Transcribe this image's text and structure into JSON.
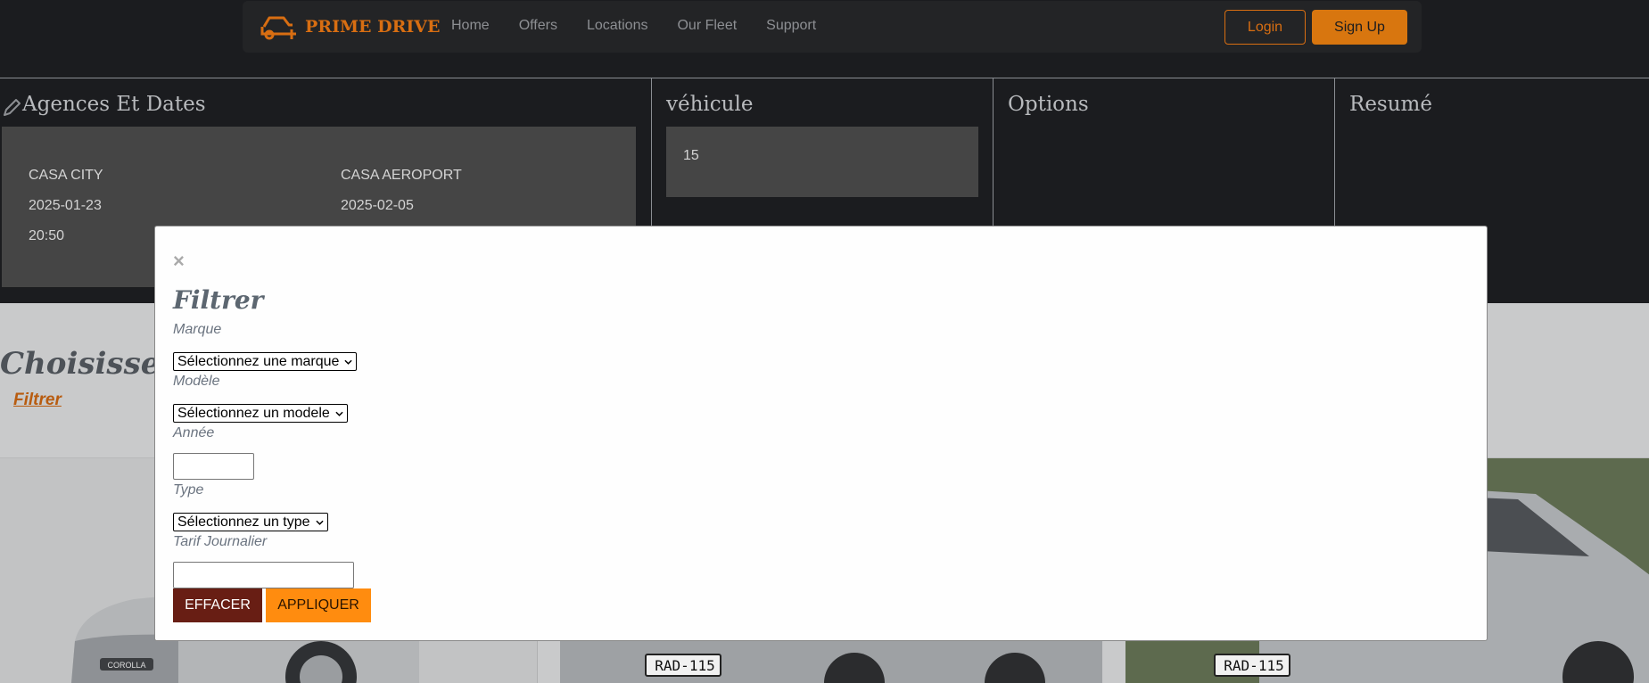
{
  "nav": {
    "brand": "PRIME DRIVE",
    "links": [
      "Home",
      "Offers",
      "Locations",
      "Our Fleet",
      "Support"
    ],
    "login": "Login",
    "signup": "Sign Up"
  },
  "steps": {
    "agencies": {
      "title": "Agences Et Dates",
      "pickup": {
        "agency": "CASA CITY",
        "date": "2025-01-23",
        "time": "20:50"
      },
      "return": {
        "agency": "CASA AEROPORT",
        "date": "2025-02-05"
      }
    },
    "vehicle": {
      "title": "véhicule",
      "value": "15"
    },
    "options": {
      "title": "Options"
    },
    "summary": {
      "title": "Resumé"
    }
  },
  "main": {
    "heading": "Choisissez v",
    "filter_link": "Filtrer"
  },
  "modal": {
    "close": "×",
    "title": "Filtrer",
    "brand_label": "Marque",
    "brand_select": "Sélectionnez une marque",
    "model_label": "Modèle",
    "model_select": "Sélectionnez un modele",
    "year_label": "Année",
    "year_value": "",
    "type_label": "Type",
    "type_select": "Sélectionnez un type",
    "rate_label": "Tarif Journalier",
    "rate_value": "",
    "clear_button": "EFFACER",
    "apply_button": "APPLIQUER"
  },
  "cards": [
    {
      "model_badge": "COROLLA"
    },
    {
      "plate": "RAD-115"
    },
    {
      "plate": "RAD-115"
    }
  ],
  "colors": {
    "accent": "#d86e12",
    "apply": "#ff8c0f",
    "clear": "#681e14",
    "dark_bg": "#1b1c1f"
  }
}
